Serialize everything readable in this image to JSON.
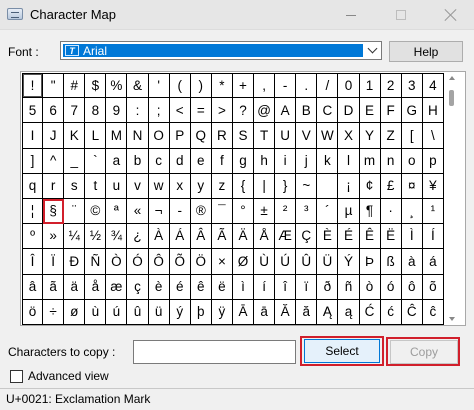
{
  "window": {
    "title": "Character Map"
  },
  "font": {
    "label": "Font :",
    "selected": "Arial",
    "type_icon_glyph": "Т"
  },
  "buttons": {
    "help": "Help",
    "select": "Select",
    "copy": "Copy"
  },
  "grid": {
    "selected_char": "!",
    "highlighted_char": "§",
    "rows": [
      [
        "!",
        "\"",
        "#",
        "$",
        "%",
        "&",
        "'",
        "(",
        ")",
        "*",
        "+",
        ",",
        "-",
        ".",
        "/",
        "0",
        "1",
        "2",
        "3",
        "4"
      ],
      [
        "5",
        "6",
        "7",
        "8",
        "9",
        ":",
        ";",
        "<",
        "=",
        ">",
        "?",
        "@",
        "A",
        "B",
        "C",
        "D",
        "E",
        "F",
        "G",
        "H"
      ],
      [
        "I",
        "J",
        "K",
        "L",
        "M",
        "N",
        "O",
        "P",
        "Q",
        "R",
        "S",
        "T",
        "U",
        "V",
        "W",
        "X",
        "Y",
        "Z",
        "[",
        "\\"
      ],
      [
        "]",
        "^",
        "_",
        "`",
        "a",
        "b",
        "c",
        "d",
        "e",
        "f",
        "g",
        "h",
        "i",
        "j",
        "k",
        "l",
        "m",
        "n",
        "o",
        "p"
      ],
      [
        "q",
        "r",
        "s",
        "t",
        "u",
        "v",
        "w",
        "x",
        "y",
        "z",
        "{",
        "|",
        "}",
        "~",
        " ",
        "¡",
        "¢",
        "£",
        "¤",
        "¥"
      ],
      [
        "¦",
        "§",
        "¨",
        "©",
        "ª",
        "«",
        "¬",
        "-",
        "®",
        "¯",
        "°",
        "±",
        "²",
        "³",
        "´",
        "µ",
        "¶",
        "·",
        "¸",
        "¹"
      ],
      [
        "º",
        "»",
        "¼",
        "½",
        "¾",
        "¿",
        "À",
        "Á",
        "Â",
        "Ã",
        "Ä",
        "Å",
        "Æ",
        "Ç",
        "È",
        "É",
        "Ê",
        "Ë",
        "Ì",
        "Í"
      ],
      [
        "Î",
        "Ï",
        "Ð",
        "Ñ",
        "Ò",
        "Ó",
        "Ô",
        "Õ",
        "Ö",
        "×",
        "Ø",
        "Ù",
        "Ú",
        "Û",
        "Ü",
        "Ý",
        "Þ",
        "ß",
        "à",
        "á"
      ],
      [
        "â",
        "ã",
        "ä",
        "å",
        "æ",
        "ç",
        "è",
        "é",
        "ê",
        "ë",
        "ì",
        "í",
        "î",
        "ï",
        "ð",
        "ñ",
        "ò",
        "ó",
        "ô",
        "õ"
      ],
      [
        "ö",
        "÷",
        "ø",
        "ù",
        "ú",
        "û",
        "ü",
        "ý",
        "þ",
        "ÿ",
        "Ā",
        "ā",
        "Ă",
        "ă",
        "Ą",
        "ą",
        "Ć",
        "ć",
        "Ĉ",
        "ĉ"
      ]
    ]
  },
  "copy_field": {
    "label": "Characters to copy :",
    "value": ""
  },
  "advanced": {
    "label": "Advanced view",
    "checked": false
  },
  "status": {
    "text": "U+0021: Exclamation Mark"
  },
  "colors": {
    "highlight_red": "#d11f2b",
    "select_blue": "#0078d7"
  }
}
